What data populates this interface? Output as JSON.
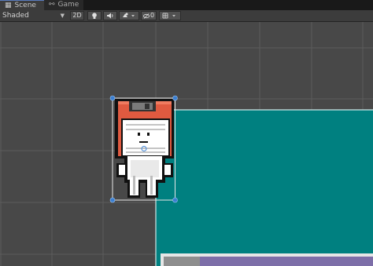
{
  "tabs": [
    {
      "label": "Scene",
      "icon": "scene-icon"
    },
    {
      "label": "Game",
      "icon": "gamepad-icon"
    }
  ],
  "toolbar": {
    "shading_mode": "Shaded",
    "mode_2d_label": "2D",
    "gizmo_count": "0",
    "icons": [
      "dropdown-arrow-icon",
      "lightbulb-icon",
      "audio-speaker-icon",
      "effects-icon",
      "visibility-icon",
      "grid-snap-icon"
    ]
  },
  "scene": {
    "background_color": "#484848",
    "grid_color": "#5c5c5c",
    "tilemap_color": "#008080",
    "selection_color": "#3b7fd1",
    "inner_panel_color": "#7d6ea8",
    "sprite_icon": "floppy-disk-character"
  }
}
